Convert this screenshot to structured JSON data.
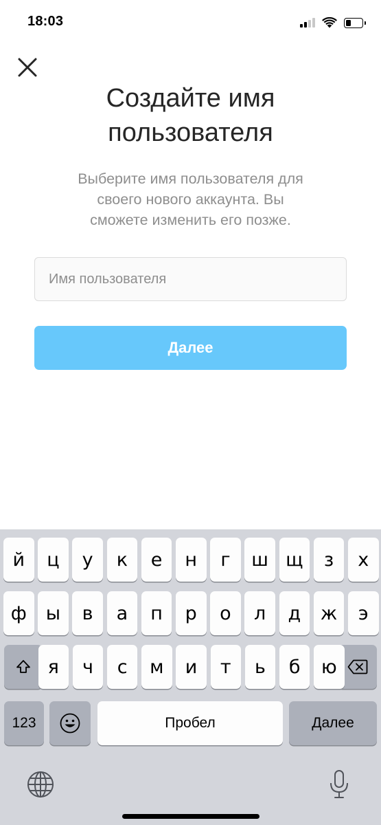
{
  "status_bar": {
    "time": "18:03",
    "battery_level": 0.3
  },
  "header": {
    "close_icon": "close-icon",
    "title_line1": "Создайте имя",
    "title_line2": "пользователя",
    "subtitle_line1": "Выберите имя пользователя для",
    "subtitle_line2": "своего нового аккаунта. Вы",
    "subtitle_line3": "сможете изменить его позже."
  },
  "form": {
    "username_value": "",
    "username_placeholder": "Имя пользователя",
    "next_label": "Далее"
  },
  "keyboard": {
    "row1": [
      "й",
      "ц",
      "у",
      "к",
      "е",
      "н",
      "г",
      "ш",
      "щ",
      "з",
      "х"
    ],
    "row2": [
      "ф",
      "ы",
      "в",
      "а",
      "п",
      "р",
      "о",
      "л",
      "д",
      "ж",
      "э"
    ],
    "row3": [
      "я",
      "ч",
      "с",
      "м",
      "и",
      "т",
      "ь",
      "б",
      "ю"
    ],
    "numbers_label": "123",
    "space_label": "Пробел",
    "return_label": "Далее",
    "shift_icon": "shift-icon",
    "backspace_icon": "backspace-icon",
    "emoji_icon": "emoji-icon",
    "globe_icon": "globe-icon",
    "mic_icon": "microphone-icon"
  },
  "colors": {
    "accent_button": "#67c8fb",
    "keyboard_bg": "#d3d5db"
  }
}
